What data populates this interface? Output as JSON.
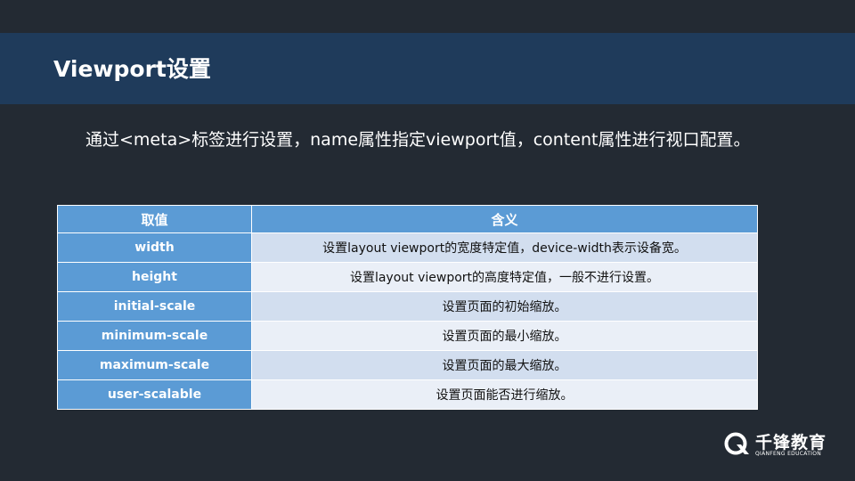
{
  "slide": {
    "title": "Viewport设置",
    "intro": "通过<meta>标签进行设置，name属性指定viewport值，content属性进行视口配置。"
  },
  "table": {
    "headers": [
      "取值",
      "含义"
    ],
    "rows": [
      {
        "key": "width",
        "value": "设置layout viewport的宽度特定值，device-width表示设备宽。"
      },
      {
        "key": "height",
        "value": "设置layout viewport的高度特定值，一般不进行设置。"
      },
      {
        "key": "initial-scale",
        "value": "设置页面的初始缩放。"
      },
      {
        "key": "minimum-scale",
        "value": "设置页面的最小缩放。"
      },
      {
        "key": "maximum-scale",
        "value": "设置页面的最大缩放。"
      },
      {
        "key": "user-scalable",
        "value": "设置页面能否进行缩放。"
      }
    ]
  },
  "logo": {
    "name": "千锋教育",
    "subtitle": "QIANFENG EDUCATION",
    "icon": "qianfeng-logo-icon"
  },
  "colors": {
    "background": "#232a33",
    "title_bar": "#1f3b5b",
    "table_header": "#5b9bd5",
    "row_odd": "#d2deef",
    "row_even": "#eaeff7"
  }
}
